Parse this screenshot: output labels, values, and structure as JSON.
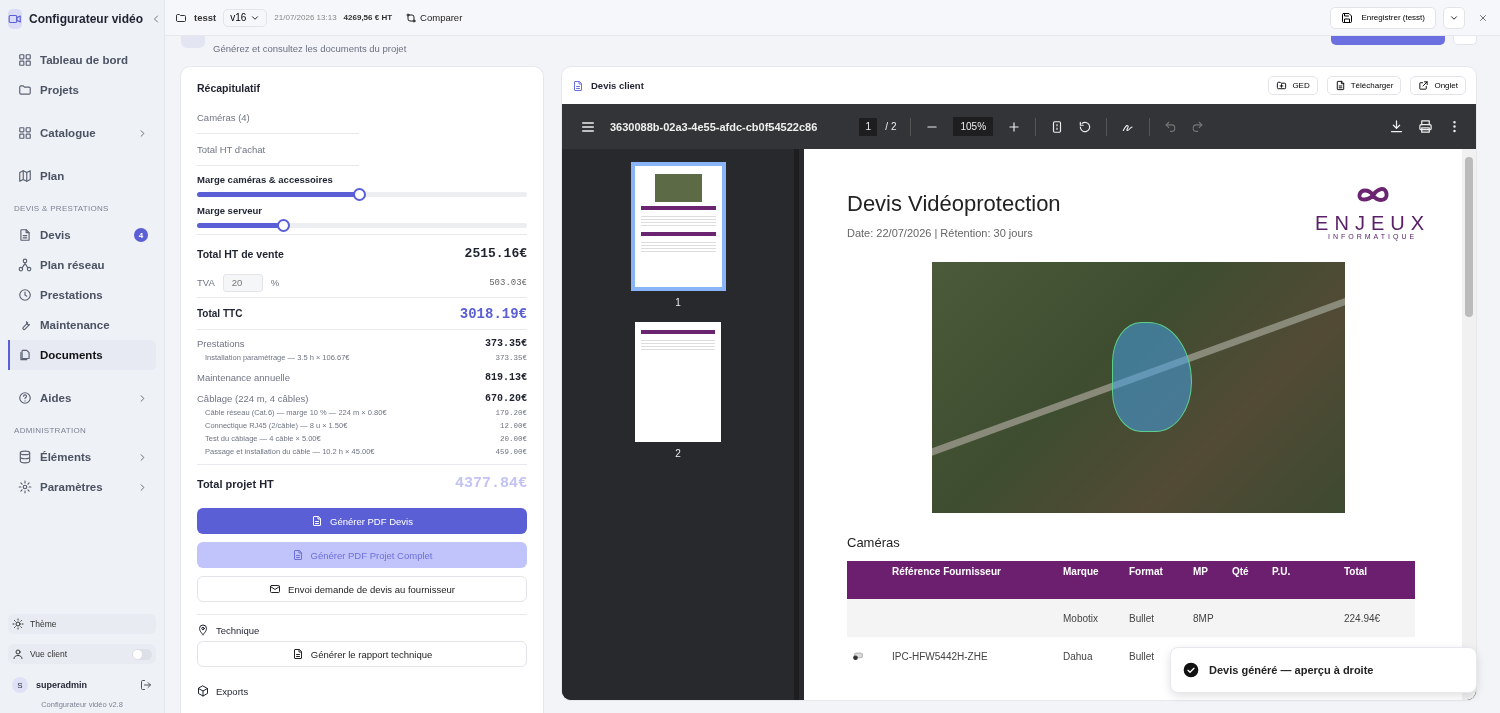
{
  "sidebar": {
    "brand": "Configurateur vidéo",
    "groups": [
      {
        "items": [
          {
            "label": "Tableau de bord",
            "selected": false,
            "submenu": false
          },
          {
            "label": "Projets",
            "selected": false,
            "submenu": false
          }
        ]
      },
      {
        "items": [
          {
            "label": "Catalogue",
            "selected": false,
            "submenu": true
          }
        ]
      },
      {
        "items": [
          {
            "label": "Plan",
            "selected": false,
            "submenu": false
          }
        ]
      },
      {
        "title": "DEVIS & PRESTATIONS",
        "items": [
          {
            "label": "Devis",
            "selected": false,
            "submenu": false,
            "badge": "4"
          },
          {
            "label": "Plan réseau",
            "selected": false,
            "submenu": false
          },
          {
            "label": "Prestations",
            "selected": false,
            "submenu": false
          },
          {
            "label": "Maintenance",
            "selected": false,
            "submenu": false
          },
          {
            "label": "Documents",
            "selected": true,
            "submenu": false
          }
        ]
      },
      {
        "items": [
          {
            "label": "Aides",
            "selected": false,
            "submenu": true
          }
        ]
      },
      {
        "title": "ADMINISTRATION",
        "items": [
          {
            "label": "Éléments",
            "selected": false,
            "submenu": true
          },
          {
            "label": "Paramètres",
            "selected": false,
            "submenu": true
          }
        ]
      }
    ],
    "theme": "Thème",
    "client_view": {
      "label": "Vue client",
      "on": false
    },
    "user": {
      "initial": "S",
      "name": "superadmin"
    },
    "version": "Configurateur vidéo v2.8"
  },
  "topbar": {
    "project": "tesst",
    "version": "v16",
    "date": "21/07/2026 13:13",
    "amount": "4269,56 € HT",
    "compare": "Comparer",
    "save": "Enregistrer (tesst)"
  },
  "header": {
    "subtitle": "Générez et consultez les documents du projet"
  },
  "summary": {
    "title": "Récapitulatif",
    "rows": [
      {
        "kind": "muted",
        "label": "Caméras (4)"
      },
      {
        "kind": "muted",
        "label": "Total HT d'achat"
      },
      {
        "kind": "slider",
        "label": "Marge caméras & accessoires",
        "level": 0.49
      },
      {
        "kind": "slider",
        "label": "Marge serveur",
        "level": 0.26
      },
      {
        "kind": "total",
        "label": "Total HT de vente",
        "value": "2515.16€"
      },
      {
        "kind": "tva",
        "label": "TVA",
        "input": "20",
        "unit": "%",
        "value": "503.03€"
      },
      {
        "kind": "ttc",
        "label": "Total TTC",
        "value": "3018.19€"
      },
      {
        "kind": "group",
        "label": "Prestations",
        "value": "373.35€",
        "details": [
          {
            "label": "Installation paramétrage — 3.5 h × 106.67€",
            "value": "373.35€"
          }
        ]
      },
      {
        "kind": "group",
        "label": "Maintenance annuelle",
        "value": "819.13€"
      },
      {
        "kind": "group",
        "label": "Câblage (224 m, 4 câbles)",
        "value": "670.20€",
        "details": [
          {
            "label": "Câble réseau (Cat.6) — marge 10 % — 224 m × 0.80€",
            "value": "179.20€"
          },
          {
            "label": "Connectique RJ45 (2/câble) — 8 u × 1.50€",
            "value": "12.00€"
          },
          {
            "label": "Test du câblage — 4 câble × 5.00€",
            "value": "20.00€"
          },
          {
            "label": "Passage et installation du câble — 10.2 h × 45.00€",
            "value": "459.00€"
          }
        ]
      },
      {
        "kind": "grand",
        "label": "Total projet HT",
        "value": "4377.84€"
      }
    ],
    "actions": [
      {
        "kind": "primary",
        "label": "Générer PDF Devis"
      },
      {
        "kind": "faded",
        "label": "Générer PDF Projet Complet"
      },
      {
        "kind": "outline",
        "label": "Envoi demande de devis au fournisseur"
      }
    ],
    "technique": {
      "title": "Technique",
      "button": "Générer le rapport technique"
    },
    "exports": {
      "title": "Exports"
    }
  },
  "preview": {
    "title": "Devis client",
    "buttons": [
      "GED",
      "Télécharger",
      "Onglet"
    ],
    "viewer": {
      "filename": "3630088b-02a3-4e55-afdc-cb0f54522c86",
      "page": "1",
      "pages": "/ 2",
      "zoom": "105%",
      "thumbnails": [
        {
          "label": "1",
          "selected": true
        },
        {
          "label": "2",
          "selected": false
        }
      ]
    },
    "document": {
      "title": "Devis Vidéoprotection",
      "meta": "Date: 22/07/2026 | Rétention: 30 jours",
      "logo_main": "ENJEUX",
      "logo_sub": "INFORMATIQUE",
      "section": "Caméras",
      "columns": [
        "Référence Fournisseur",
        "Marque",
        "Format",
        "MP",
        "Qté",
        "P.U.",
        "Total"
      ],
      "rows": [
        {
          "image": false,
          "brand": "Mobotix",
          "format": "Bullet",
          "mp": "8MP",
          "total": "224.94€"
        },
        {
          "image": true,
          "reference": "IPC-HFW5442H-ZHE",
          "brand": "Dahua",
          "format": "Bullet"
        }
      ]
    }
  },
  "toast": {
    "message": "Devis généré — aperçu à droite"
  }
}
